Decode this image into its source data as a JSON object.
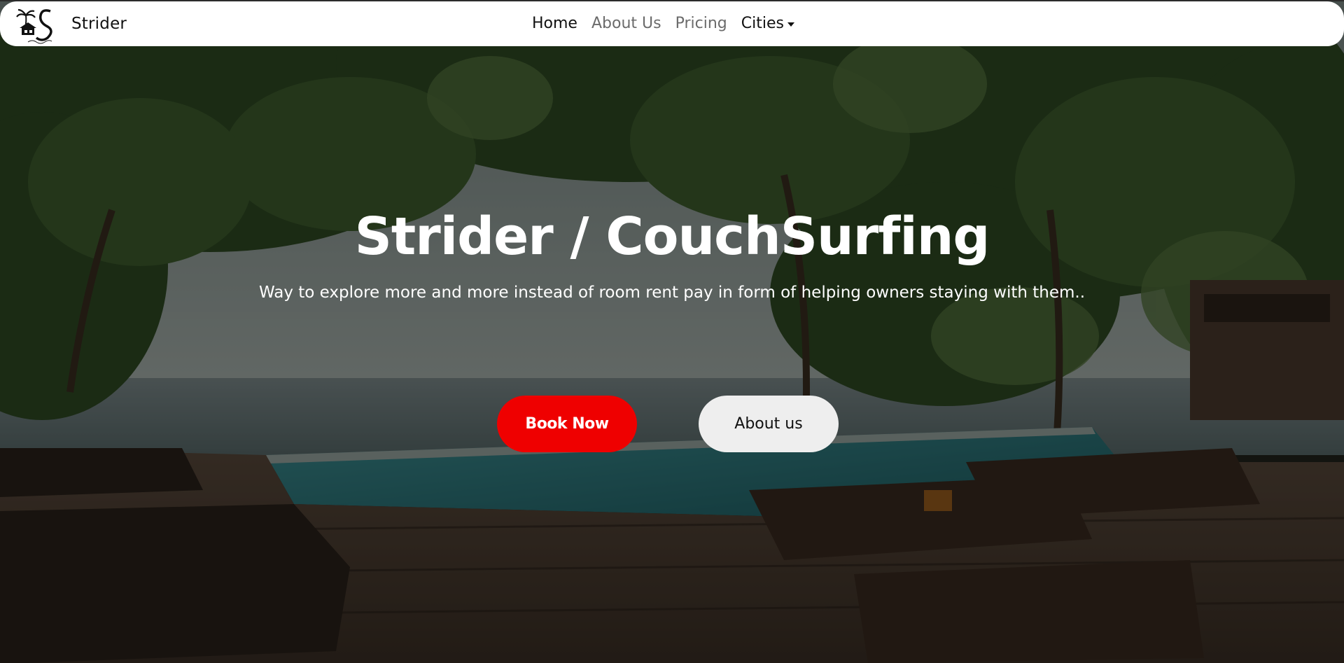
{
  "navbar": {
    "brand": "Strider",
    "links": {
      "home": "Home",
      "about": "About Us",
      "pricing": "Pricing",
      "cities": "Cities"
    }
  },
  "hero": {
    "title": "Strider / CouchSurfing",
    "subtitle": "Way to explore more and more instead of room rent pay in form of helping owners staying with them..",
    "book_button": "Book Now",
    "about_button": "About us"
  },
  "colors": {
    "accent": "#ef0000",
    "navbar_bg": "#ffffff",
    "secondary_button_bg": "#eeeeee"
  }
}
